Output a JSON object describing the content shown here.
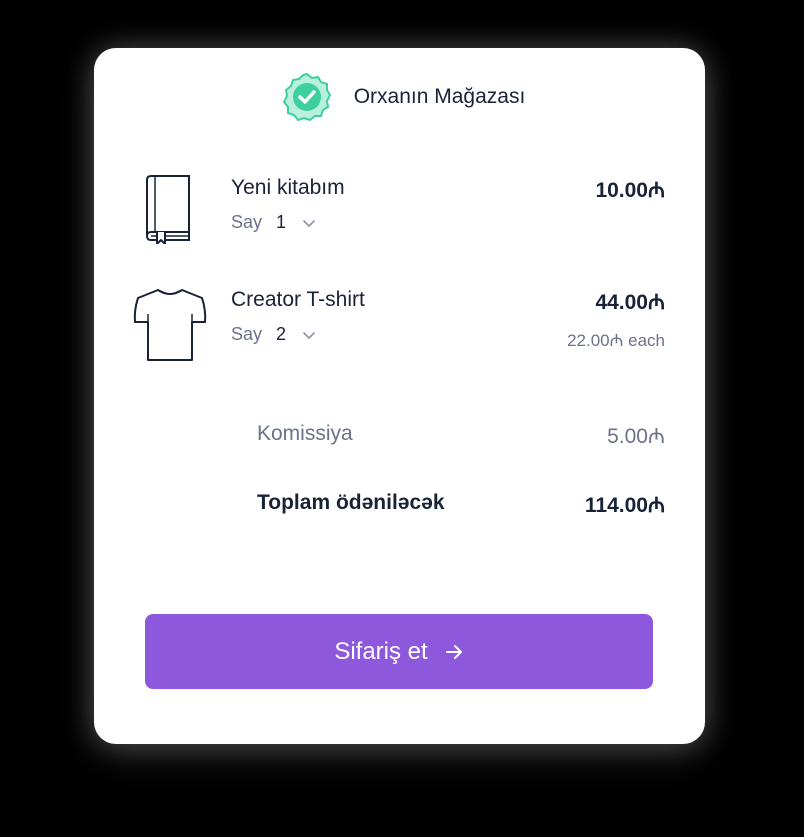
{
  "store": {
    "name": "Orxanın Mağazası",
    "badge_icon": "verified-check-icon",
    "badge_color": "#3ecf9f"
  },
  "products": [
    {
      "name": "Yeni kitabım",
      "icon": "book-icon",
      "qty_label": "Say",
      "qty_value": "1",
      "price": "10.00₼"
    },
    {
      "name": "Creator T-shirt",
      "icon": "tshirt-icon",
      "qty_label": "Say",
      "qty_value": "2",
      "price": "44.00₼",
      "unit_price": "22.00₼ each"
    }
  ],
  "summary": {
    "fee_label": "Komissiya",
    "fee_value": "5.00₼",
    "total_label": "Toplam ödəniləcək",
    "total_value": "114.00₼"
  },
  "order_button": {
    "label": "Sifariş et",
    "icon": "arrow-right-icon",
    "color": "#8d58dc"
  }
}
